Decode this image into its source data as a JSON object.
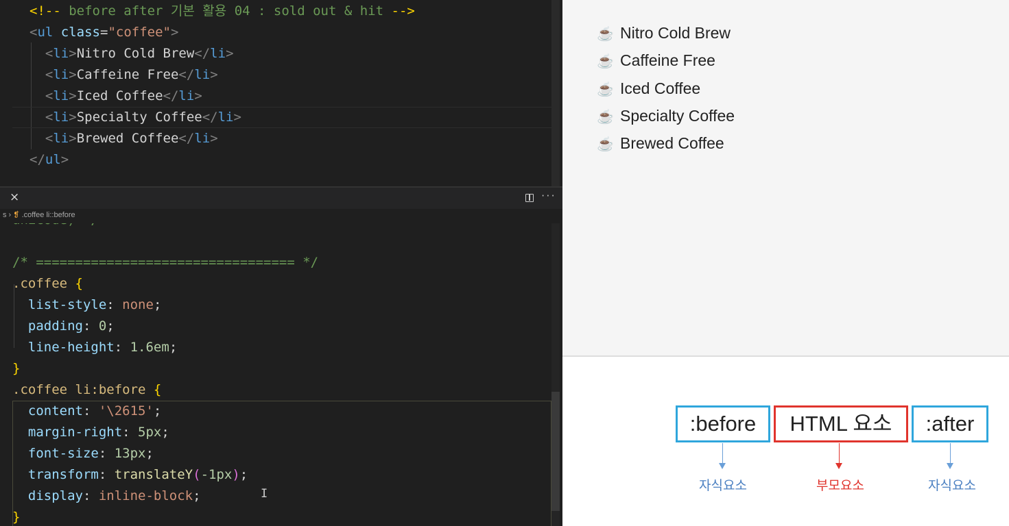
{
  "colors": {
    "blue": "#2fa6dc",
    "red": "#e0342d",
    "label_blue": "#4a7fc1",
    "label_red": "#e0342d",
    "editor_bg": "#1f1f1f",
    "preview_bg": "#f5f5f5"
  },
  "html_editor": {
    "lines": [
      [
        [
          "<!-- ",
          "cb"
        ],
        [
          "before after 기본 활용 04 : sold out & hit ",
          "cmt"
        ],
        [
          "-->",
          "cb"
        ]
      ],
      [
        [
          "<",
          "br"
        ],
        [
          "ul ",
          "tag"
        ],
        [
          "class",
          "attr"
        ],
        [
          "=",
          "txt"
        ],
        [
          "\"coffee\"",
          "str"
        ],
        [
          ">",
          "br"
        ]
      ],
      [
        [
          "  ",
          "txt"
        ],
        [
          "<",
          "br"
        ],
        [
          "li",
          "tag"
        ],
        [
          ">",
          "br"
        ],
        [
          "Nitro Cold Brew",
          "txt"
        ],
        [
          "</",
          "br"
        ],
        [
          "li",
          "tag"
        ],
        [
          ">",
          "br"
        ]
      ],
      [
        [
          "  ",
          "txt"
        ],
        [
          "<",
          "br"
        ],
        [
          "li",
          "tag"
        ],
        [
          ">",
          "br"
        ],
        [
          "Caffeine Free",
          "txt"
        ],
        [
          "</",
          "br"
        ],
        [
          "li",
          "tag"
        ],
        [
          ">",
          "br"
        ]
      ],
      [
        [
          "  ",
          "txt"
        ],
        [
          "<",
          "br"
        ],
        [
          "li",
          "tag"
        ],
        [
          ">",
          "br"
        ],
        [
          "Iced Coffee",
          "txt"
        ],
        [
          "</",
          "br"
        ],
        [
          "li",
          "tag"
        ],
        [
          ">",
          "br"
        ]
      ],
      [
        [
          "  ",
          "txt"
        ],
        [
          "<",
          "br"
        ],
        [
          "li",
          "tag"
        ],
        [
          ">",
          "br"
        ],
        [
          "Specialty Coffee",
          "txt"
        ],
        [
          "</",
          "br"
        ],
        [
          "li",
          "tag"
        ],
        [
          ">",
          "br"
        ]
      ],
      [
        [
          "  ",
          "txt"
        ],
        [
          "<",
          "br"
        ],
        [
          "li",
          "tag"
        ],
        [
          ">",
          "br"
        ],
        [
          "Brewed Coffee",
          "txt"
        ],
        [
          "</",
          "br"
        ],
        [
          "li",
          "tag"
        ],
        [
          ">",
          "br"
        ]
      ],
      [
        [
          "</",
          "br"
        ],
        [
          "ul",
          "tag"
        ],
        [
          ">",
          "br"
        ]
      ]
    ]
  },
  "tab": {
    "close": "×",
    "split_icon": "split-editor-icon",
    "more": "···"
  },
  "breadcrumb": {
    "prefix": "s ›",
    "icon": "css-selector-icon",
    "item": ".coffee li::before"
  },
  "css_editor": {
    "lines": [
      [
        [
          "unicode) */",
          "cmt"
        ]
      ],
      [
        [
          "",
          "txt"
        ]
      ],
      [
        [
          "/* ================================= */",
          "cmt"
        ]
      ],
      [
        [
          ".coffee ",
          "sel"
        ],
        [
          "{",
          "cb"
        ]
      ],
      [
        [
          "  list-style",
          "prop"
        ],
        [
          ": ",
          "pun"
        ],
        [
          "none",
          "val"
        ],
        [
          ";",
          "pun"
        ]
      ],
      [
        [
          "  padding",
          "prop"
        ],
        [
          ": ",
          "pun"
        ],
        [
          "0",
          "num"
        ],
        [
          ";",
          "pun"
        ]
      ],
      [
        [
          "  line-height",
          "prop"
        ],
        [
          ": ",
          "pun"
        ],
        [
          "1.6em",
          "num"
        ],
        [
          ";",
          "pun"
        ]
      ],
      [
        [
          "}",
          "cb"
        ]
      ],
      [
        [
          ".coffee li:before ",
          "sel"
        ],
        [
          "{",
          "cb"
        ]
      ],
      [
        [
          "  content",
          "prop"
        ],
        [
          ": ",
          "pun"
        ],
        [
          "'\\2615'",
          "val"
        ],
        [
          ";",
          "pun"
        ]
      ],
      [
        [
          "  margin-right",
          "prop"
        ],
        [
          ": ",
          "pun"
        ],
        [
          "5px",
          "num"
        ],
        [
          ";",
          "pun"
        ]
      ],
      [
        [
          "  font-size",
          "prop"
        ],
        [
          ": ",
          "pun"
        ],
        [
          "13px",
          "num"
        ],
        [
          ";",
          "pun"
        ]
      ],
      [
        [
          "  transform",
          "prop"
        ],
        [
          ": ",
          "pun"
        ],
        [
          "translateY",
          "fn"
        ],
        [
          "(",
          "pb"
        ],
        [
          "-1px",
          "num"
        ],
        [
          ")",
          "pb"
        ],
        [
          ";",
          "pun"
        ]
      ],
      [
        [
          "  display",
          "prop"
        ],
        [
          ": ",
          "pun"
        ],
        [
          "inline-block",
          "val"
        ],
        [
          ";",
          "pun"
        ]
      ],
      [
        [
          "}",
          "cb"
        ]
      ]
    ]
  },
  "preview": {
    "icon": "☕",
    "items": [
      "Nitro Cold Brew",
      "Caffeine Free",
      "Iced Coffee",
      "Specialty Coffee",
      "Brewed Coffee"
    ]
  },
  "diagram": {
    "before": ":before",
    "element": "HTML 요소",
    "after": ":after",
    "before_label": "자식요소",
    "element_label": "부모요소",
    "after_label": "자식요소"
  }
}
